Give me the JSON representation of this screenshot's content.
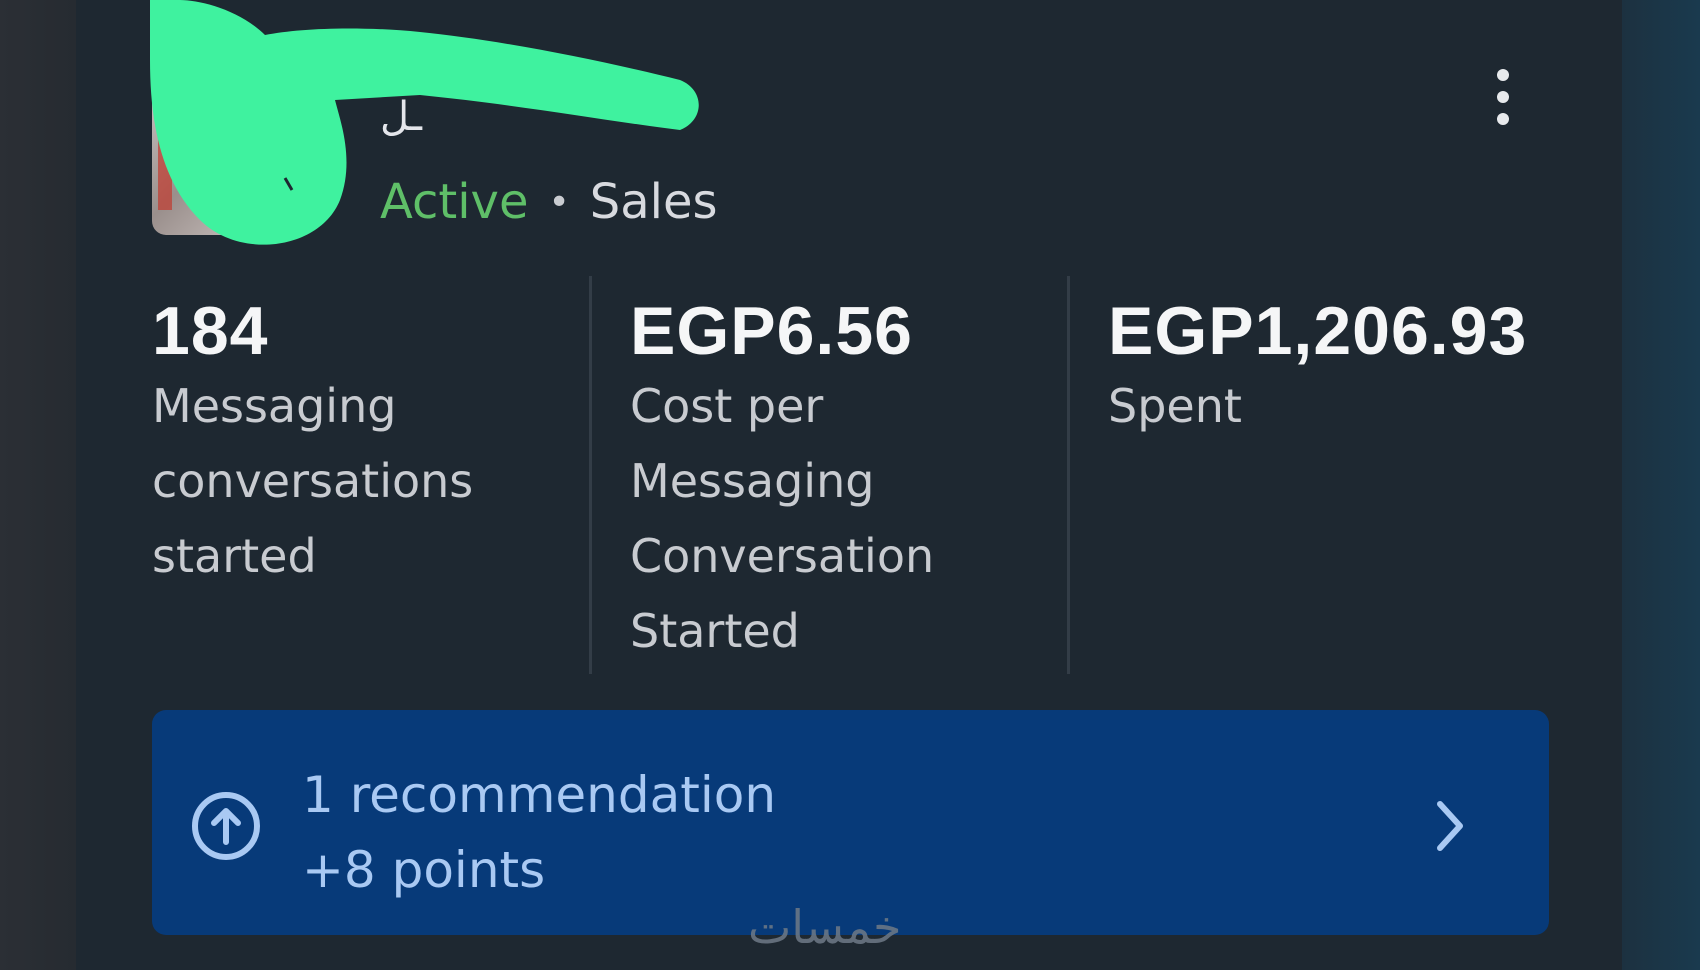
{
  "campaign": {
    "name": "ـل",
    "status": "Active",
    "objective": "Sales",
    "status_color": "#5fbf68"
  },
  "menu": {
    "icon": "more-vertical-icon"
  },
  "metrics": [
    {
      "value": "184",
      "label": "Messaging conversations started"
    },
    {
      "value": "EGP6.56",
      "label": "Cost per Messaging Conversation Started"
    },
    {
      "value": "EGP1,206.93",
      "label": "Spent"
    }
  ],
  "recommendation": {
    "title": "1 recommendation",
    "points": "+8 points",
    "icon": "arrow-up-circle-icon",
    "chevron_icon": "chevron-right-icon",
    "background": "#073a79",
    "text_color": "#a9c9f3"
  },
  "watermark": {
    "text": "خمسات"
  },
  "redaction": {
    "color": "#3ff29f"
  }
}
